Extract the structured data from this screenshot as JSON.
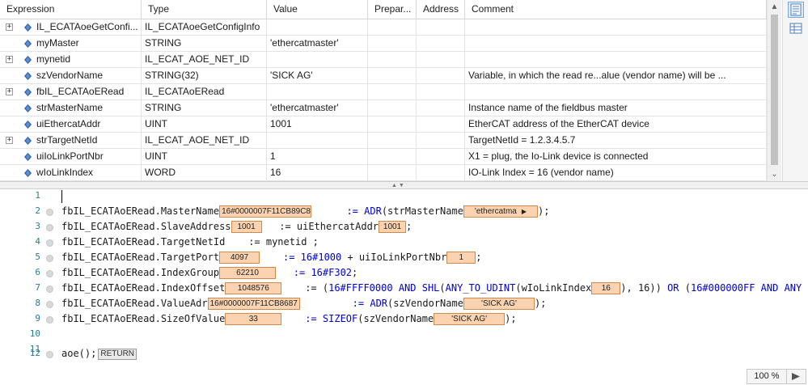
{
  "decl": {
    "columns": [
      "Expression",
      "Type",
      "Value",
      "Prepar...",
      "Address",
      "Comment"
    ],
    "rows": [
      {
        "expr": "IL_ECATAoeGetConfi...",
        "type": "IL_ECATAoeGetConfigInfo",
        "value": "",
        "comment": "",
        "expandable": true
      },
      {
        "expr": "myMaster",
        "type": "STRING",
        "value": "'ethercatmaster'",
        "comment": "",
        "expandable": false
      },
      {
        "expr": "mynetid",
        "type": "IL_ECAT_AOE_NET_ID",
        "value": "",
        "comment": "",
        "expandable": true
      },
      {
        "expr": "szVendorName",
        "type": "STRING(32)",
        "value": "'SICK AG'",
        "comment": "Variable, in which the read re...alue (vendor name) will be ...",
        "expandable": false
      },
      {
        "expr": "fbIL_ECATAoERead",
        "type": "IL_ECATAoERead",
        "value": "",
        "comment": "",
        "expandable": true
      },
      {
        "expr": "strMasterName",
        "type": "STRING",
        "value": "'ethercatmaster'",
        "comment": "Instance name of the fieldbus master",
        "expandable": false
      },
      {
        "expr": "uiEthercatAddr",
        "type": "UINT",
        "value": "1001",
        "comment": "EtherCAT address of the EtherCAT device",
        "expandable": false
      },
      {
        "expr": "strTargetNetId",
        "type": "IL_ECAT_AOE_NET_ID",
        "value": "",
        "comment": "TargetNetId = 1.2.3.4.5.7",
        "expandable": true
      },
      {
        "expr": "uiIoLinkPortNbr",
        "type": "UINT",
        "value": "1",
        "comment": "X1 = plug, the Io-Link device is connected",
        "expandable": false
      },
      {
        "expr": "wIoLinkIndex",
        "type": "WORD",
        "value": "16",
        "comment": "IO-Link Index = 16 (vendor name)",
        "expandable": false
      }
    ],
    "expand_glyph": "+"
  },
  "editor": {
    "lines": [
      "1",
      "2",
      "3",
      "4",
      "5",
      "6",
      "7",
      "8",
      "9",
      "10",
      "11",
      "12"
    ],
    "code": {
      "l2a": "fbIL_ECATAoERead.MasterName",
      "l2b": ":= ",
      "l2c": "ADR",
      "l2d": "(strMasterName",
      "l2e": ");",
      "l3a": "fbIL_ECATAoERead.SlaveAddress",
      "l3b": ":= uiEthercatAddr",
      "l3c": ";",
      "l4a": "fbIL_ECATAoERead.TargetNetId    := mynetid ;",
      "l5a": "fbIL_ECATAoERead.TargetPort",
      "l5b": ":= ",
      "l5c": "16#1000",
      "l5d": " + uiIoLinkPortNbr",
      "l5e": ";",
      "l6a": "fbIL_ECATAoERead.IndexGroup",
      "l6b": ":= ",
      "l6c": "16#F302",
      "l6d": ";",
      "l7a": "fbIL_ECATAoERead.IndexOffset",
      "l7b": ":= (",
      "l7c": "16#FFFF0000",
      "l7d": " AND ",
      "l7e": "SHL",
      "l7f": "(",
      "l7g": "ANY_TO_UDINT",
      "l7h": "(wIoLinkIndex",
      "l7i": "), 16)) ",
      "l7j": "OR",
      "l7k": " (",
      "l7l": "16#000000FF",
      "l7m": " AND ANY",
      "l8a": "fbIL_ECATAoERead.ValueAdr",
      "l8b": ":= ",
      "l8c": "ADR",
      "l8d": "(szVendorName",
      "l8e": ");",
      "l9a": "fbIL_ECATAoERead.SizeOfValue",
      "l9b": ":= ",
      "l9c": "SIZEOF",
      "l9d": "(szVendorName",
      "l9e": ");",
      "l12a": "aoe();"
    },
    "monitors": {
      "masterName": "16#0000007F11CB89C8",
      "strMasterName": "'ethercatma",
      "slaveAddress": "1001",
      "uiEthercatAddr": "1001",
      "targetPort": "4097",
      "uiIoLinkPortNbr": "1",
      "indexGroup": "62210",
      "indexOffset": "1048576",
      "wIoLinkIndex": "16",
      "valueAdr": "16#0000007F11CB8687",
      "szVendorName1": "'SICK AG'",
      "sizeOfValue": "33",
      "szVendorName2": "'SICK AG'"
    },
    "return_label": "RETURN"
  },
  "status": {
    "zoom": "100 %"
  },
  "icons": {
    "variable": "variable-icon",
    "expand": "expand-icon",
    "declaration_view": "declaration-view-icon",
    "table_view": "table-view-icon"
  },
  "colors": {
    "monitor_bg": "#fbd3b0",
    "monitor_border": "#d08a4e",
    "keyword": "#0000cc",
    "line_number": "#2b7a8c"
  }
}
